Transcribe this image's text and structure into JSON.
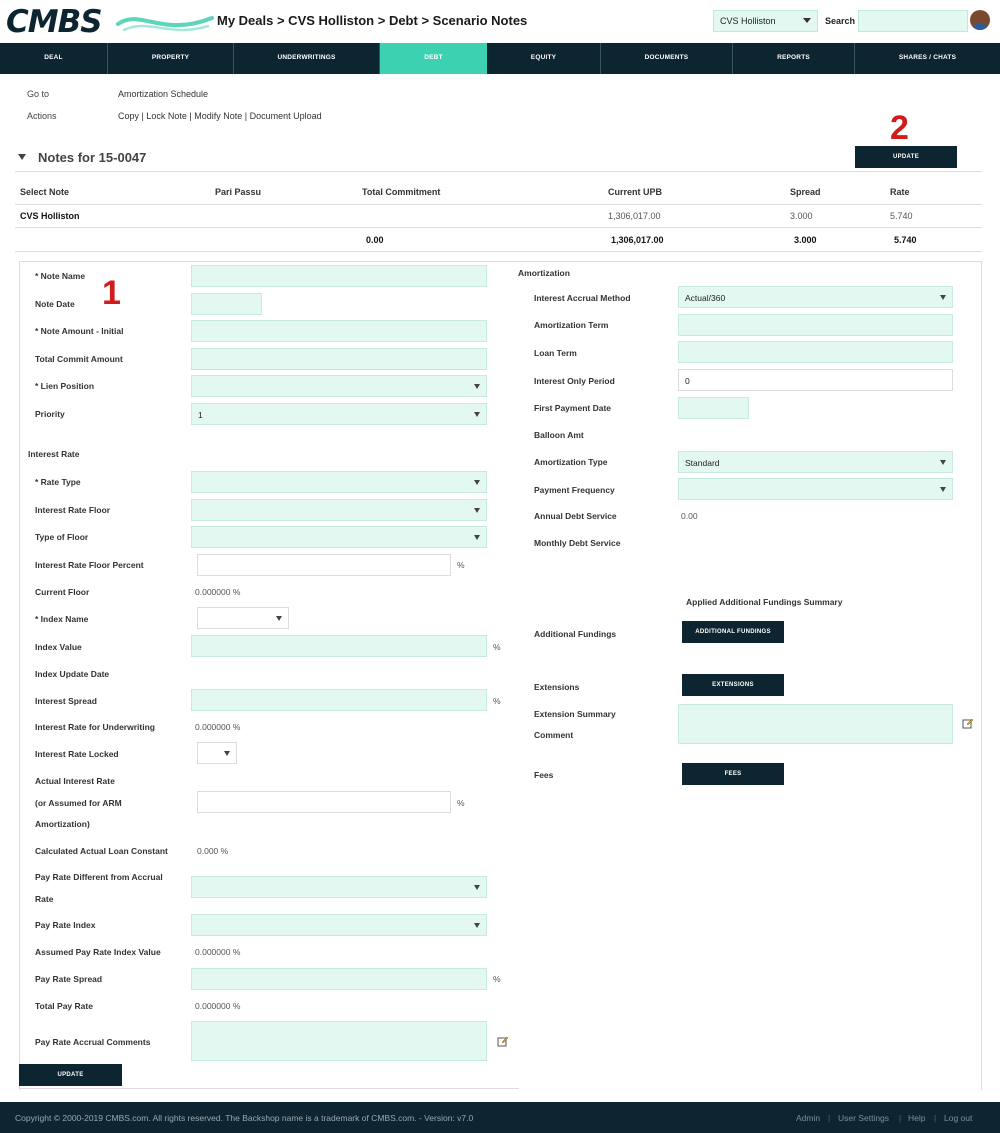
{
  "header": {
    "logo_text": "CMBS",
    "breadcrumb": "My Deals > CVS Holliston > Debt > Scenario Notes",
    "deal_select": "CVS Holliston",
    "search_label": "Search"
  },
  "nav": [
    "DEAL",
    "PROPERTY",
    "UNDERWRITINGS",
    "DEBT",
    "EQUITY",
    "DOCUMENTS",
    "REPORTS",
    "SHARES / CHATS"
  ],
  "nav_active": "DEBT",
  "goto": {
    "label": "Go to",
    "value": "Amortization Schedule"
  },
  "actions": {
    "label": "Actions",
    "value": "Copy | Lock Note | Modify Note | Document Upload"
  },
  "markers": {
    "one": "1",
    "two": "2"
  },
  "notes_title": "Notes for 15-0047",
  "update_label": "UPDATE",
  "table": {
    "headers": [
      "Select Note",
      "Pari Passu",
      "Total Commitment",
      "Current UPB",
      "Spread",
      "Rate"
    ],
    "row": {
      "name": "CVS Holliston",
      "upb": "1,306,017.00",
      "spread": "3.000",
      "rate": "5.740"
    },
    "totals": {
      "commitment": "0.00",
      "upb": "1,306,017.00",
      "spread": "3.000",
      "rate": "5.740"
    }
  },
  "left": {
    "note_name": "* Note Name",
    "note_date": "Note Date",
    "note_amount": "* Note Amount - Initial",
    "total_commit": "Total Commit Amount",
    "lien_position": "* Lien Position",
    "priority": "Priority",
    "priority_value": "1",
    "interest_rate": "Interest Rate",
    "rate_type": "* Rate Type",
    "floor": "Interest Rate Floor",
    "type_of_floor": "Type of Floor",
    "floor_percent": "Interest Rate Floor Percent",
    "current_floor": "Current Floor",
    "current_floor_value": "0.000000 %",
    "index_name": "* Index Name",
    "index_value": "Index Value",
    "index_update": "Index Update Date",
    "spread": "Interest Spread",
    "rate_uw": "Interest Rate for Underwriting",
    "rate_uw_value": "0.000000 %",
    "rate_locked": "Interest Rate Locked",
    "actual_rate_1": "Actual Interest Rate",
    "actual_rate_2": "(or Assumed for ARM",
    "actual_rate_3": "Amortization)",
    "calc_constant": "Calculated Actual Loan Constant",
    "calc_constant_value": "0.000 %",
    "pay_diff_1": "Pay Rate Different from Accrual",
    "pay_diff_2": "Rate",
    "pay_index": "Pay Rate Index",
    "assumed_pay": "Assumed Pay Rate Index Value",
    "assumed_pay_value": "0.000000 %",
    "pay_spread": "Pay Rate Spread",
    "total_pay": "Total Pay Rate",
    "total_pay_value": "0.000000 %",
    "pay_comments": "Pay Rate Accrual Comments",
    "pct": "%"
  },
  "right": {
    "amortization": "Amortization",
    "accrual_method": "Interest Accrual Method",
    "accrual_method_value": "Actual/360",
    "amort_term": "Amortization Term",
    "loan_term": "Loan Term",
    "io_period": "Interest Only Period",
    "io_period_value": "0",
    "first_payment": "First Payment Date",
    "balloon": "Balloon Amt",
    "amort_type": "Amortization Type",
    "amort_type_value": "Standard",
    "pay_freq": "Payment Frequency",
    "annual_ds": "Annual Debt Service",
    "annual_ds_value": "0.00",
    "monthly_ds": "Monthly Debt Service",
    "applied_summary": "Applied Additional Fundings Summary",
    "additional_fundings": "Additional Fundings",
    "additional_fundings_btn": "ADDITIONAL FUNDINGS",
    "extensions": "Extensions",
    "extensions_btn": "EXTENSIONS",
    "ext_summary_1": "Extension Summary",
    "ext_summary_2": "Comment",
    "fees": "Fees",
    "fees_btn": "FEES"
  },
  "footer": {
    "copyright": "Copyright © 2000-2019 CMBS.com. All rights reserved. The Backshop name is a trademark of CMBS.com. - Version: v7.0",
    "links": [
      "Admin",
      "User Settings",
      "Help",
      "Log out"
    ],
    "sep": "|"
  },
  "colors": {
    "navy": "#0d2530",
    "teal": "#3cd1b0",
    "input_bg": "#e3f8f1",
    "marker": "#d21c1c"
  }
}
